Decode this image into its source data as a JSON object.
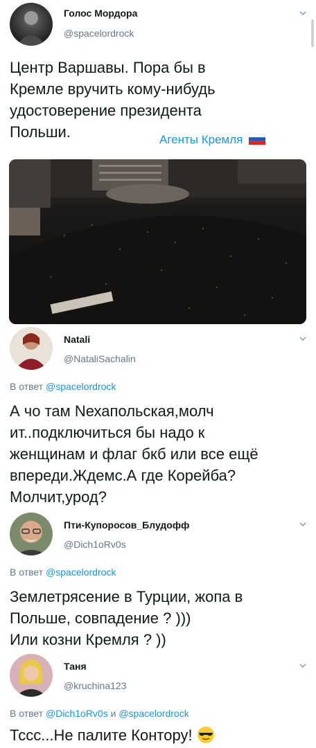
{
  "tweets": [
    {
      "display_name": "Голос Мордора",
      "handle": "@spacelordrock",
      "text_lines": [
        "Центр Варшавы. Пора бы в",
        "Кремле вручить кому-нибудь",
        "удостоверение президента",
        "Польши."
      ],
      "hashtag": "Агенты Кремля"
    },
    {
      "display_name": "Natali",
      "handle": "@NataliSachalin",
      "reply_prefix": "В ответ",
      "reply_to": "@spacelordrock",
      "text_lines": [
        "А чо там Nехапольская,молч",
        "ит..подключиться бы надо к",
        "женщинам и флаг бкб или все ещё",
        "впереди.Ждемс.А где Корейба?",
        "Молчит,урод?"
      ]
    },
    {
      "display_name": "Пти-Купоросов_Блудофф",
      "handle": "@Dich1oRv0s",
      "reply_prefix": "В ответ",
      "reply_to": "@spacelordrock",
      "text_lines": [
        "Землетрясение в Турции, жопа в",
        "Польше, совпадение ? )))",
        "Или козни Кремля ? ))"
      ]
    },
    {
      "display_name": "Таня",
      "handle": "@kruchina123",
      "reply_prefix": "В ответ",
      "reply_to": "@Dich1oRv0s",
      "reply_conj": "и",
      "reply_to2": "@spacelordrock",
      "text_lines": [
        "Тссс...Не палите Контору!"
      ]
    }
  ],
  "icons": {
    "chevron": "chevron-down-icon",
    "flag": "russian-flag-icon",
    "emoji": "sunglasses-emoji-icon"
  },
  "colors": {
    "link": "#1b95e0",
    "secondary": "#657786",
    "text": "#14171a"
  }
}
